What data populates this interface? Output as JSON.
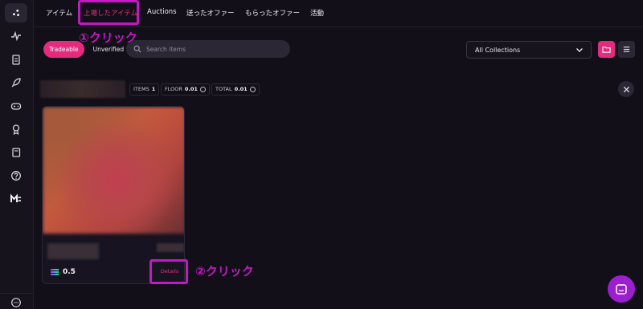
{
  "nav": {
    "tabs": [
      {
        "label": "アイテム"
      },
      {
        "label": "上場したアイテム"
      },
      {
        "label": "Auctions"
      },
      {
        "label": "送ったオファー"
      },
      {
        "label": "もらったオファー"
      },
      {
        "label": "活動"
      }
    ],
    "active_tab": "上場したアイテム"
  },
  "annotations": {
    "step1": "①クリック",
    "step2": "②クリック",
    "highlight_color": "#c418c6"
  },
  "filters": {
    "tradeable": "Tradeable",
    "unverified": "Unverified",
    "search_placeholder": "Search items",
    "collection_select": "All Collections"
  },
  "stats": {
    "items_label": "ITEMS",
    "items_value": "1",
    "floor_label": "FLOOR",
    "floor_value": "0.01",
    "total_label": "TOTAL",
    "total_value": "0.01"
  },
  "card": {
    "price": "0.5",
    "details_label": "Details"
  },
  "colors": {
    "accent": "#e42b7d",
    "background": "#120f18",
    "chat": "#9b1ecf"
  },
  "rail_icons": [
    "logo-icon",
    "activity-icon",
    "clipboard-icon",
    "rocket-icon",
    "gamepad-icon",
    "award-icon",
    "book-icon",
    "help-icon",
    "me-logo-icon",
    "more-icon"
  ]
}
